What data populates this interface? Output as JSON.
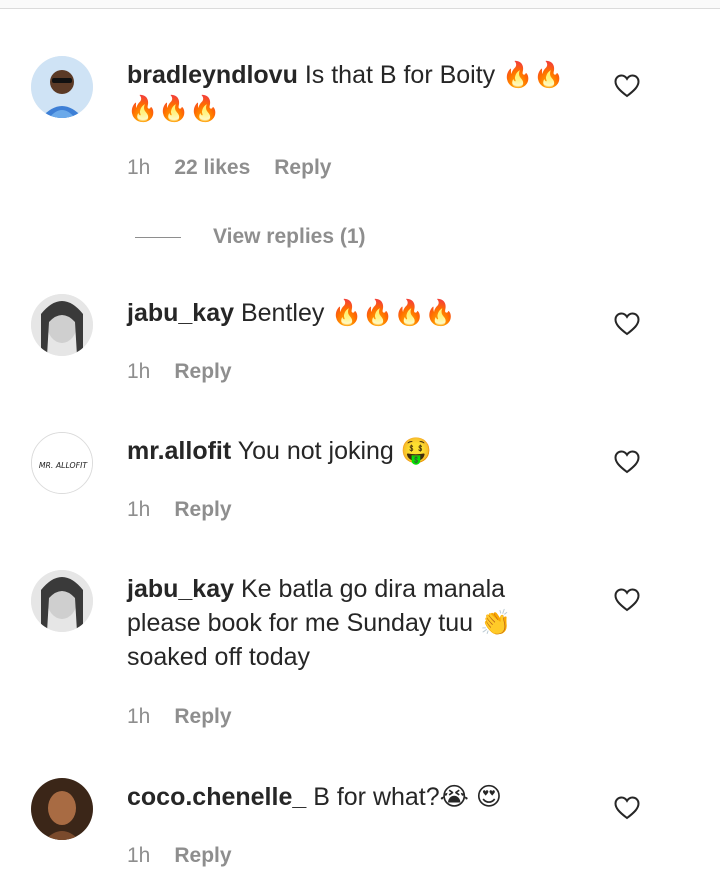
{
  "comments": [
    {
      "username": "bradleyndlovu",
      "text": "Is that B for Boity 🔥🔥🔥🔥🔥",
      "time": "1h",
      "likes": "22 likes",
      "reply": "Reply",
      "view_replies": "View replies (1)"
    },
    {
      "username": "jabu_kay",
      "text": "Bentley 🔥🔥🔥🔥",
      "time": "1h",
      "reply": "Reply"
    },
    {
      "username": "mr.allofit",
      "text": "You not joking 🤑",
      "time": "1h",
      "reply": "Reply",
      "avatar_text": "MR. ALLOFIT"
    },
    {
      "username": "jabu_kay",
      "text": "Ke batla go dira manala please book for me Sunday tuu 👏 soaked off today",
      "time": "1h",
      "reply": "Reply"
    },
    {
      "username": "coco.chenelle_",
      "text": "B for what?😭 😍",
      "time": "1h",
      "reply": "Reply"
    }
  ],
  "icons": {
    "like": "heart-outline-icon"
  },
  "colors": {
    "text": "#262626",
    "secondary": "#8e8e8e",
    "divider": "#dbdbdb"
  }
}
